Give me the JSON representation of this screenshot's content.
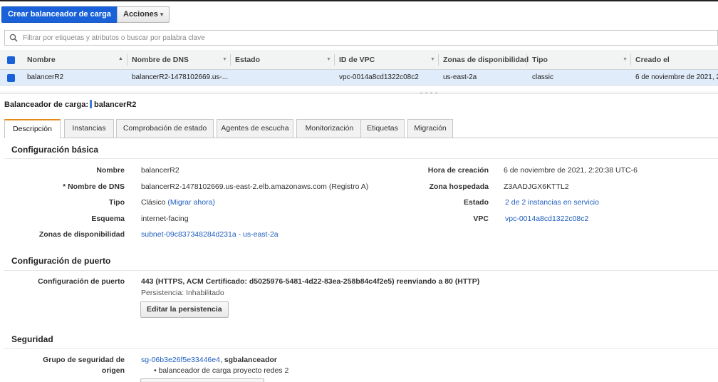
{
  "toolbar": {
    "create_label": "Crear balanceador de carga",
    "actions_label": "Acciones"
  },
  "search": {
    "placeholder": "Filtrar por etiquetas y atributos o buscar por palabra clave"
  },
  "table": {
    "columns": [
      "Nombre",
      "Nombre de DNS",
      "Estado",
      "ID de VPC",
      "Zonas de disponibilidad",
      "Tipo",
      "Creado el"
    ],
    "rows": [
      {
        "name": "balancerR2",
        "dns": "balancerR2-1478102669.us-...",
        "state": "",
        "vpc": "vpc-0014a8cd1322c08c2",
        "zones": "us-east-2a",
        "type": "classic",
        "created": "6 de noviembre de 2021, 2:2"
      }
    ]
  },
  "detail": {
    "title_prefix": "Balanceador de carga:",
    "title_name": "balancerR2",
    "tabs": [
      "Descripción",
      "Instancias",
      "Comprobación de estado",
      "Agentes de escucha",
      "Monitorización",
      "Etiquetas",
      "Migración"
    ],
    "basic": {
      "title": "Configuración básica",
      "name_label": "Nombre",
      "name_value": "balancerR2",
      "dns_label": "* Nombre de DNS",
      "dns_value": "balancerR2-1478102669.us-east-2.elb.amazonaws.com (Registro A)",
      "type_label": "Tipo",
      "type_value": "Clásico",
      "type_link": "(Migrar ahora)",
      "scheme_label": "Esquema",
      "scheme_value": "internet-facing",
      "zones_label": "Zonas de disponibilidad",
      "zones_value": "subnet-09c837348284d231a - us-east-2a",
      "created_label": "Hora de creación",
      "created_value": "6 de noviembre de 2021, 2:20:38 UTC-6",
      "hosted_zone_label": "Zona hospedada",
      "hosted_zone_value": "Z3AADJGX6KTTL2",
      "state_label": "Estado",
      "state_value": "2 de 2 instancias en servicio",
      "vpc_label": "VPC",
      "vpc_value": "vpc-0014a8cd1322c08c2"
    },
    "port": {
      "title": "Configuración de puerto",
      "label": "Configuración de puerto",
      "value": "443 (HTTPS, ACM Certificado: d5025976-5481-4d22-83ea-258b84c4f2e5) reenviando a 80 (HTTP)",
      "persistence": "Persistencia: Inhabilitado",
      "edit_button": "Editar la persistencia"
    },
    "security": {
      "title": "Seguridad",
      "sg_label_line1": "Grupo de seguridad de",
      "sg_label_line2": "origen",
      "sg_id": "sg-06b3e26f5e33446e4",
      "sg_sep": ",",
      "sg_name": "sgbalanceador",
      "sg_desc": "• balanceador de carga proyecto redes 2"
    }
  }
}
